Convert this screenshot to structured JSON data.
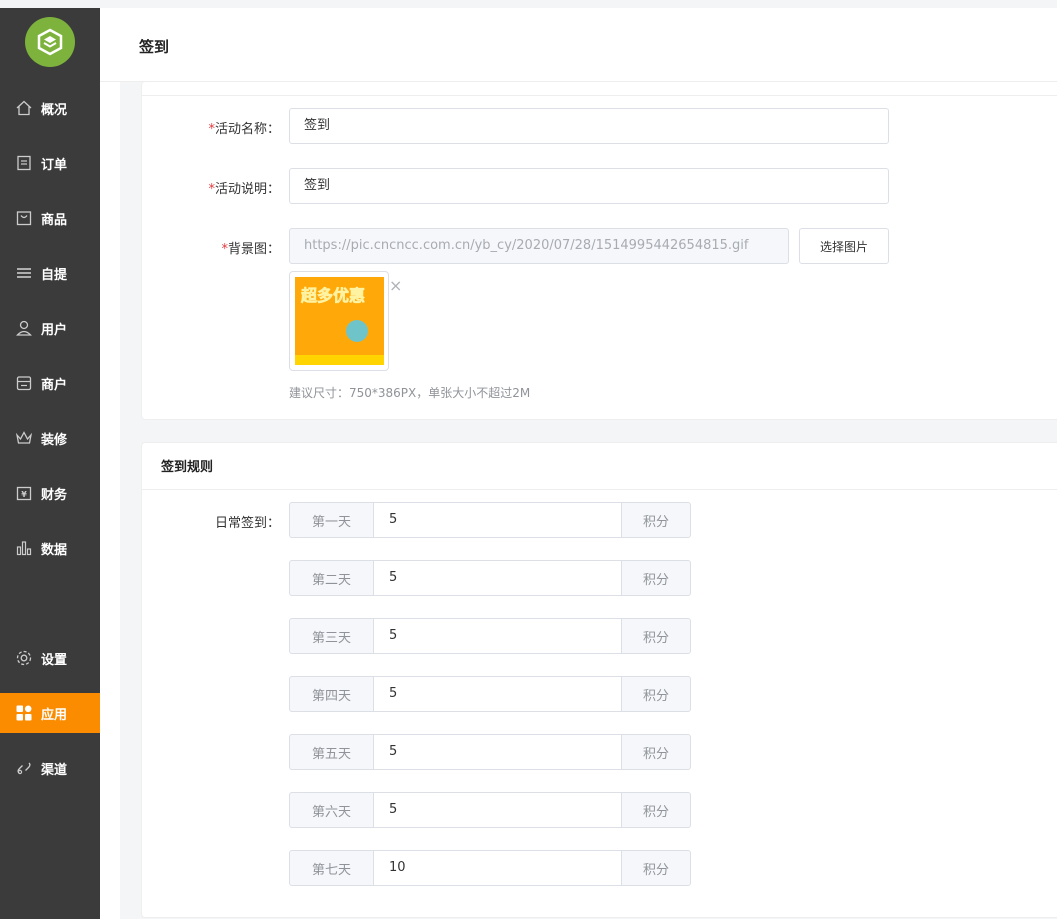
{
  "header": {
    "title": "签到"
  },
  "sidebar": {
    "items": [
      {
        "label": "概况",
        "icon": "home-icon"
      },
      {
        "label": "订单",
        "icon": "order-icon"
      },
      {
        "label": "商品",
        "icon": "bag-icon"
      },
      {
        "label": "自提",
        "icon": "menu-icon"
      },
      {
        "label": "用户",
        "icon": "user-icon"
      },
      {
        "label": "商户",
        "icon": "store-icon"
      },
      {
        "label": "装修",
        "icon": "crown-icon"
      },
      {
        "label": "财务",
        "icon": "wallet-icon"
      },
      {
        "label": "数据",
        "icon": "bar-chart-icon"
      },
      {
        "label": "设置",
        "icon": "gear-icon"
      },
      {
        "label": "应用",
        "icon": "apps-icon",
        "active": true
      },
      {
        "label": "渠道",
        "icon": "link-icon"
      }
    ],
    "active_color": "#fb8c00",
    "logo_color": "#7db33c"
  },
  "form": {
    "name": {
      "label": "活动名称：",
      "required": "*",
      "value": "签到"
    },
    "desc": {
      "label": "活动说明：",
      "required": "*",
      "value": "签到"
    },
    "bg": {
      "label": "背景图：",
      "required": "*",
      "url": "https://pic.cncncc.com.cn/yb_cy/2020/07/28/1514995442654815.gif",
      "select_button": "选择图片",
      "thumb_text": "超多优惠",
      "remove": "×",
      "hint": "建议尺寸：750*386PX，单张大小不超过2M"
    }
  },
  "rules": {
    "title": "签到规则",
    "daily_label": "日常签到：",
    "unit": "积分",
    "days": [
      {
        "day": "第一天",
        "points": "5"
      },
      {
        "day": "第二天",
        "points": "5"
      },
      {
        "day": "第三天",
        "points": "5"
      },
      {
        "day": "第四天",
        "points": "5"
      },
      {
        "day": "第五天",
        "points": "5"
      },
      {
        "day": "第六天",
        "points": "5"
      },
      {
        "day": "第七天",
        "points": "10"
      }
    ]
  }
}
